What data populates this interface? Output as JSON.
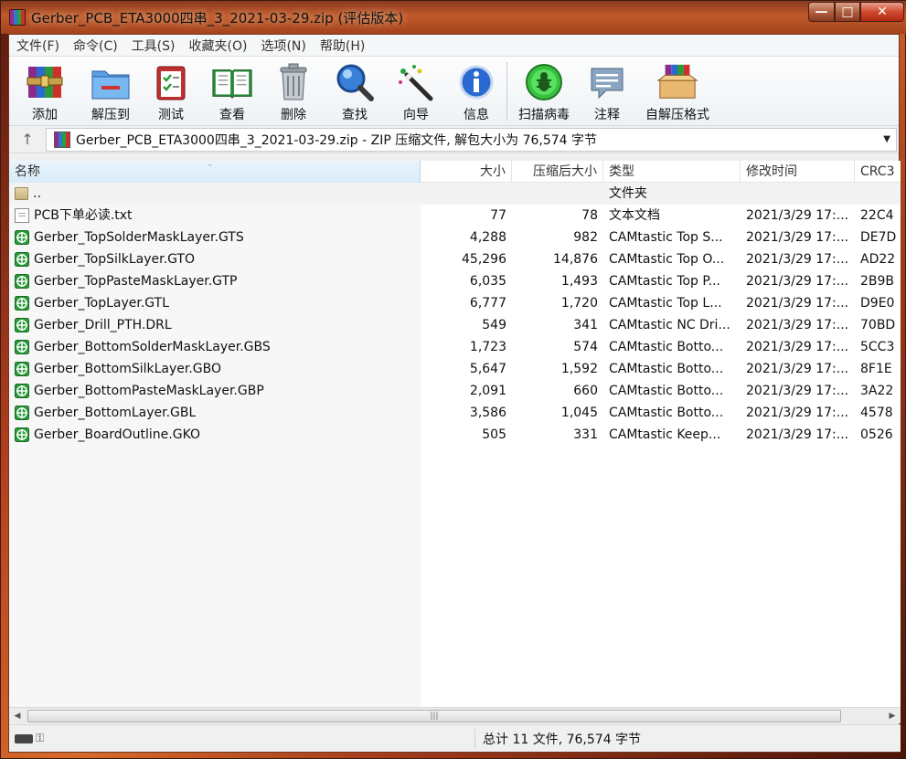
{
  "window": {
    "title": "Gerber_PCB_ETA3000四串_3_2021-03-29.zip (评估版本)",
    "buttons": {
      "minimize": "—",
      "maximize": "□",
      "close": "✕"
    }
  },
  "menu": [
    "文件(F)",
    "命令(C)",
    "工具(S)",
    "收藏夹(O)",
    "选项(N)",
    "帮助(H)"
  ],
  "toolbar": [
    {
      "label": "添加",
      "icon": "books-icon"
    },
    {
      "label": "解压到",
      "icon": "folder-extract-icon"
    },
    {
      "label": "测试",
      "icon": "checklist-icon"
    },
    {
      "label": "查看",
      "icon": "open-book-icon"
    },
    {
      "label": "删除",
      "icon": "trash-icon"
    },
    {
      "label": "查找",
      "icon": "magnifier-icon"
    },
    {
      "label": "向导",
      "icon": "wizard-wand-icon"
    },
    {
      "label": "信息",
      "icon": "info-icon"
    },
    {
      "label": "扫描病毒",
      "icon": "bug-scan-icon"
    },
    {
      "label": "注释",
      "icon": "comment-icon"
    },
    {
      "label": "自解压格式",
      "icon": "sfx-box-icon"
    }
  ],
  "address": {
    "up": "↑",
    "path": "Gerber_PCB_ETA3000四串_3_2021-03-29.zip - ZIP 压缩文件, 解包大小为 76,574 字节",
    "dropdown": "▼"
  },
  "columns": {
    "name": "名称",
    "size": "大小",
    "packed": "压缩后大小",
    "type": "类型",
    "modified": "修改时间",
    "crc": "CRC3"
  },
  "files": [
    {
      "name": "..",
      "size": "",
      "packed": "",
      "type": "文件夹",
      "modified": "",
      "crc": "",
      "icon": "folder-icon"
    },
    {
      "name": "PCB下单必读.txt",
      "size": "77",
      "packed": "78",
      "type": "文本文档",
      "modified": "2021/3/29 17:...",
      "crc": "22C4",
      "icon": "text-file-icon"
    },
    {
      "name": "Gerber_TopSolderMaskLayer.GTS",
      "size": "4,288",
      "packed": "982",
      "type": "CAMtastic Top S...",
      "modified": "2021/3/29 17:...",
      "crc": "DE7D",
      "icon": "gerber-icon"
    },
    {
      "name": "Gerber_TopSilkLayer.GTO",
      "size": "45,296",
      "packed": "14,876",
      "type": "CAMtastic Top O...",
      "modified": "2021/3/29 17:...",
      "crc": "AD22",
      "icon": "gerber-icon"
    },
    {
      "name": "Gerber_TopPasteMaskLayer.GTP",
      "size": "6,035",
      "packed": "1,493",
      "type": "CAMtastic Top P...",
      "modified": "2021/3/29 17:...",
      "crc": "2B9B",
      "icon": "gerber-icon"
    },
    {
      "name": "Gerber_TopLayer.GTL",
      "size": "6,777",
      "packed": "1,720",
      "type": "CAMtastic Top L...",
      "modified": "2021/3/29 17:...",
      "crc": "D9E0",
      "icon": "gerber-icon"
    },
    {
      "name": "Gerber_Drill_PTH.DRL",
      "size": "549",
      "packed": "341",
      "type": "CAMtastic NC Dri...",
      "modified": "2021/3/29 17:...",
      "crc": "70BD",
      "icon": "gerber-icon"
    },
    {
      "name": "Gerber_BottomSolderMaskLayer.GBS",
      "size": "1,723",
      "packed": "574",
      "type": "CAMtastic Botto...",
      "modified": "2021/3/29 17:...",
      "crc": "5CC3",
      "icon": "gerber-icon"
    },
    {
      "name": "Gerber_BottomSilkLayer.GBO",
      "size": "5,647",
      "packed": "1,592",
      "type": "CAMtastic Botto...",
      "modified": "2021/3/29 17:...",
      "crc": "8F1E",
      "icon": "gerber-icon"
    },
    {
      "name": "Gerber_BottomPasteMaskLayer.GBP",
      "size": "2,091",
      "packed": "660",
      "type": "CAMtastic Botto...",
      "modified": "2021/3/29 17:...",
      "crc": "3A22",
      "icon": "gerber-icon"
    },
    {
      "name": "Gerber_BottomLayer.GBL",
      "size": "3,586",
      "packed": "1,045",
      "type": "CAMtastic Botto...",
      "modified": "2021/3/29 17:...",
      "crc": "4578",
      "icon": "gerber-icon"
    },
    {
      "name": "Gerber_BoardOutline.GKO",
      "size": "505",
      "packed": "331",
      "type": "CAMtastic Keep...",
      "modified": "2021/3/29 17:...",
      "crc": "0526",
      "icon": "gerber-icon"
    }
  ],
  "scrollbar": {
    "left": "◀",
    "right": "▶",
    "grip": "|||"
  },
  "status": {
    "summary": "总计 11 文件, 76,574 字节"
  },
  "colors": {
    "gerber_green": "#2a9a3a",
    "frame_orange": "#c05a2a"
  }
}
